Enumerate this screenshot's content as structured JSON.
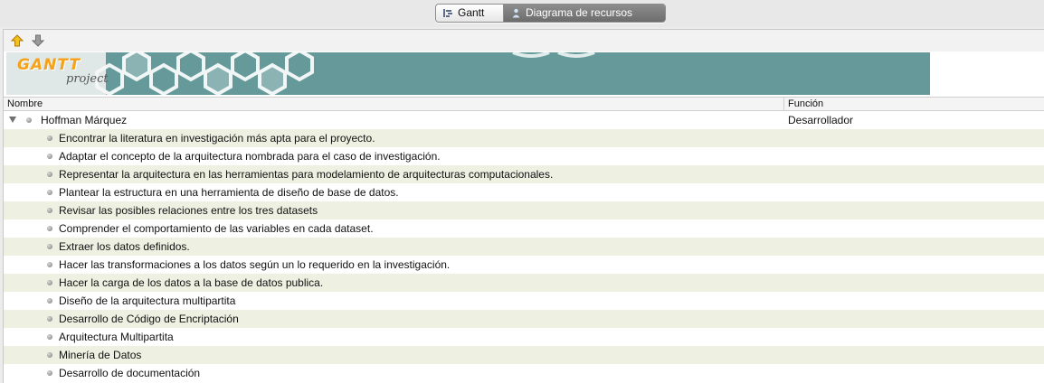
{
  "tabs": [
    {
      "label": "Gantt",
      "icon": "gantt-chart-icon",
      "active": false
    },
    {
      "label": "Diagrama de recursos",
      "icon": "resources-icon",
      "active": true
    }
  ],
  "toolbar": {
    "move_up_icon": "arrow-up-icon",
    "move_down_icon": "arrow-down-icon"
  },
  "banner": {
    "logo_main": "GANTT",
    "logo_sub": "project",
    "color": "#669a9a"
  },
  "columns": {
    "name": "Nombre",
    "role": "Función"
  },
  "resource": {
    "name": "Hoffman Márquez",
    "role": "Desarrollador"
  },
  "tasks": [
    "Encontrar la literatura en investigación más apta para el proyecto.",
    "Adaptar el concepto de la arquitectura nombrada para el caso de investigación.",
    "Representar la arquitectura en las herramientas para modelamiento de arquitecturas computacionales.",
    "Plantear la estructura en una herramienta de diseño de base de datos.",
    "Revisar las posibles relaciones entre los tres datasets",
    "Comprender el comportamiento de las variables en cada dataset.",
    "Extraer los datos definidos.",
    "Hacer las transformaciones a los datos según un lo requerido en la investigación.",
    "Hacer la carga de los datos a la base de datos publica.",
    "Diseño de la arquitectura multipartita",
    "Desarrollo de Código de Encriptación",
    "Arquitectura Multipartita",
    "Minería de Datos",
    "Desarrollo de documentación"
  ]
}
